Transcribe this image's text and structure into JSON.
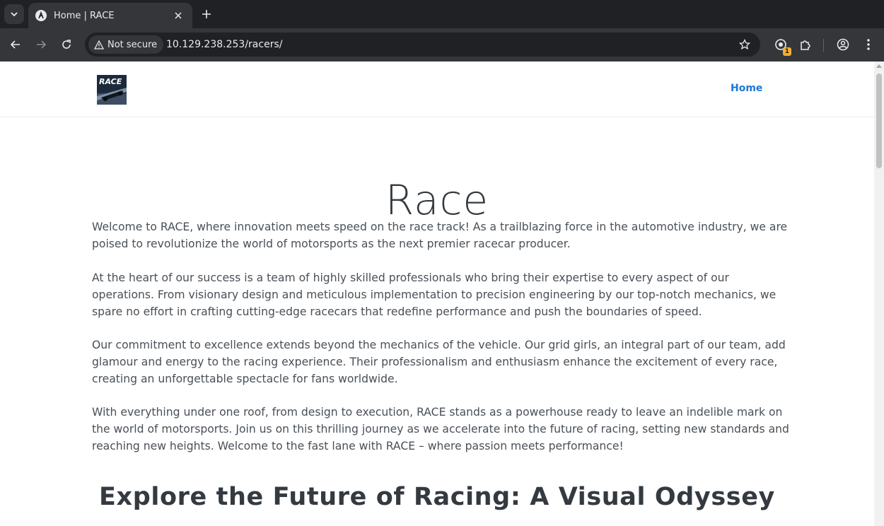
{
  "browser": {
    "tab": {
      "title": "Home | RACE"
    },
    "omnibox": {
      "security_label": "Not secure",
      "url": "10.129.238.253/racers/"
    },
    "extension_badge": "1"
  },
  "site": {
    "logo_alt": "RACE",
    "nav": {
      "home_label": "Home"
    },
    "hero_title": "Race",
    "paragraphs": [
      "Welcome to RACE, where innovation meets speed on the race track! As a trailblazing force in the automotive industry, we are poised to revolutionize the world of motorsports as the next premier racecar producer.",
      "At the heart of our success is a team of highly skilled professionals who bring their expertise to every aspect of our operations. From visionary design and meticulous implementation to precision engineering by our top-notch mechanics, we spare no effort in crafting cutting-edge racecars that redefine performance and push the boundaries of speed.",
      "Our commitment to excellence extends beyond the mechanics of the vehicle. Our grid girls, an integral part of our team, add glamour and energy to the racing experience. Their professionalism and enthusiasm enhance the excitement of every race, creating an unforgettable spectacle for fans worldwide.",
      "With everything under one roof, from design to execution, RACE stands as a powerhouse ready to leave an indelible mark on the world of motorsports. Join us on this thrilling journey as we accelerate into the future of racing, setting new standards and reaching new heights. Welcome to the fast lane with RACE – where passion meets performance!"
    ],
    "section_title": "Explore the Future of Racing: A Visual Odyssey"
  },
  "colors": {
    "chrome_dark": "#202124",
    "chrome_mid": "#35363a",
    "link_blue": "#1e76d3",
    "text_body": "#495057",
    "text_heading": "#343a40"
  }
}
